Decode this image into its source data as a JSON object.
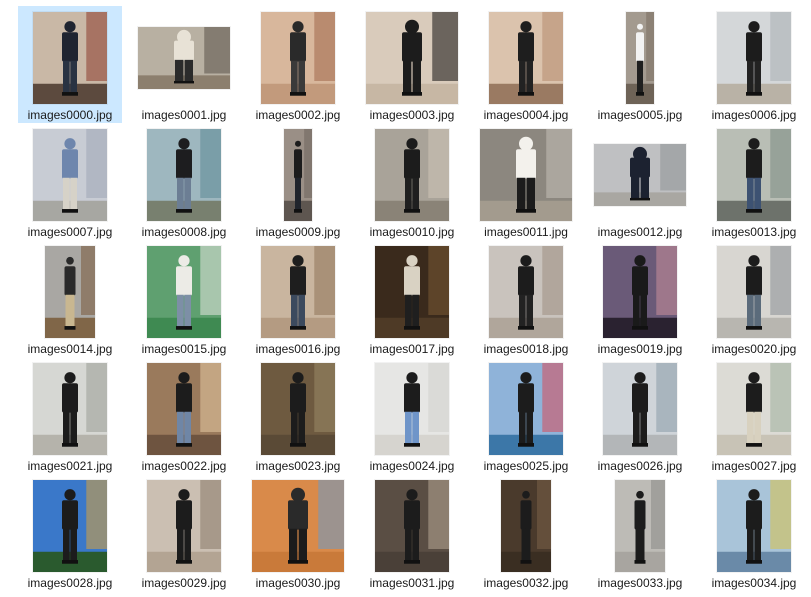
{
  "window": {
    "view": "Large icons",
    "selected_index": 0
  },
  "files": [
    {
      "name": "images0000.jpg",
      "shape": "portrait",
      "scene": {
        "bg": "#c9b8a6",
        "accent": "#8a3b2b",
        "floor": "#5c4a3e",
        "figure": "#1f2430",
        "legs": "#2a3342"
      }
    },
    {
      "name": "images0001.jpg",
      "shape": "landscape",
      "scene": {
        "bg": "#b8b0a2",
        "accent": "#5a5248",
        "floor": "#8c7f6e",
        "figure": "#e8e2d6",
        "legs": "#2b2b2b"
      }
    },
    {
      "name": "images0002.jpg",
      "shape": "portrait",
      "scene": {
        "bg": "#d8b79c",
        "accent": "#a0674a",
        "floor": "#c29a7c",
        "figure": "#2a2a2a",
        "legs": "#3a3a3a"
      }
    },
    {
      "name": "images0003.jpg",
      "shape": "landscape-tall",
      "scene": {
        "bg": "#d9cbbb",
        "accent": "#111111",
        "floor": "#c7b7a4",
        "figure": "#1c1c1c",
        "legs": "#1c1c1c"
      }
    },
    {
      "name": "images0004.jpg",
      "shape": "portrait",
      "scene": {
        "bg": "#dbc3ad",
        "accent": "#b58a6e",
        "floor": "#9a7a62",
        "figure": "#1e1e1e",
        "legs": "#222222"
      }
    },
    {
      "name": "images0005.jpg",
      "shape": "narrow",
      "scene": {
        "bg": "#a39a8f",
        "accent": "#7a6d60",
        "floor": "#6e6357",
        "figure": "#f2f2f2",
        "legs": "#1f1f1f"
      }
    },
    {
      "name": "images0006.jpg",
      "shape": "portrait",
      "scene": {
        "bg": "#d4d7d9",
        "accent": "#a8aeb3",
        "floor": "#b9b2a6",
        "figure": "#1c1c1c",
        "legs": "#222222"
      }
    },
    {
      "name": "images0007.jpg",
      "shape": "portrait",
      "scene": {
        "bg": "#c8ccd4",
        "accent": "#9ea6b4",
        "floor": "#a7a7a2",
        "figure": "#6e86ad",
        "legs": "#d6d2c8"
      }
    },
    {
      "name": "images0008.jpg",
      "shape": "portrait",
      "scene": {
        "bg": "#9eb7bf",
        "accent": "#5d8a96",
        "floor": "#78806f",
        "figure": "#1d1d1f",
        "legs": "#6c7e94"
      }
    },
    {
      "name": "images0009.jpg",
      "shape": "narrow",
      "scene": {
        "bg": "#9a8f86",
        "accent": "#6e655c",
        "floor": "#5e5650",
        "figure": "#1c1c1c",
        "legs": "#20242c"
      }
    },
    {
      "name": "images0010.jpg",
      "shape": "portrait",
      "scene": {
        "bg": "#a9a399",
        "accent": "#cfc7b8",
        "floor": "#8a8377",
        "figure": "#1c1c1c",
        "legs": "#1f1f1f"
      }
    },
    {
      "name": "images0011.jpg",
      "shape": "landscape-tall",
      "scene": {
        "bg": "#8c877f",
        "accent": "#c5c0b8",
        "floor": "#a39b8e",
        "figure": "#f3f1ec",
        "legs": "#1c1c1c"
      }
    },
    {
      "name": "images0012.jpg",
      "shape": "landscape",
      "scene": {
        "bg": "#bfc0c2",
        "accent": "#8e9196",
        "floor": "#a9a7a2",
        "figure": "#1c2230",
        "legs": "#1c2230"
      }
    },
    {
      "name": "images0013.jpg",
      "shape": "portrait",
      "scene": {
        "bg": "#b9beb5",
        "accent": "#7c8a82",
        "floor": "#6d726b",
        "figure": "#1c1c1c",
        "legs": "#3d5272"
      }
    },
    {
      "name": "images0014.jpg",
      "shape": "narrow-wide",
      "scene": {
        "bg": "#a9a7a3",
        "accent": "#7a5a3c",
        "floor": "#806648",
        "figure": "#2a2a2a",
        "legs": "#c9b790"
      }
    },
    {
      "name": "images0015.jpg",
      "shape": "portrait",
      "scene": {
        "bg": "#5fa070",
        "accent": "#e3e6e0",
        "floor": "#3f8a52",
        "figure": "#ecebe6",
        "legs": "#7d8fa6"
      }
    },
    {
      "name": "images0016.jpg",
      "shape": "portrait",
      "scene": {
        "bg": "#c9b59f",
        "accent": "#8e7358",
        "floor": "#b49b82",
        "figure": "#1e1e1e",
        "legs": "#3c4a5e"
      }
    },
    {
      "name": "images0017.jpg",
      "shape": "portrait",
      "scene": {
        "bg": "#3a2a1c",
        "accent": "#7a5a34",
        "floor": "#4e3a26",
        "figure": "#d9d2c3",
        "legs": "#1f1f1f"
      }
    },
    {
      "name": "images0018.jpg",
      "shape": "portrait",
      "scene": {
        "bg": "#c9c3bd",
        "accent": "#9c8e82",
        "floor": "#b0a69b",
        "figure": "#1c1c1c",
        "legs": "#222222"
      }
    },
    {
      "name": "images0019.jpg",
      "shape": "portrait",
      "scene": {
        "bg": "#6a5a78",
        "accent": "#c88f9a",
        "floor": "#2a2230",
        "figure": "#1a1a1a",
        "legs": "#1a1a1a"
      }
    },
    {
      "name": "images0020.jpg",
      "shape": "portrait",
      "scene": {
        "bg": "#d8d6d1",
        "accent": "#8a8f96",
        "floor": "#b8b6b0",
        "figure": "#1c1c1c",
        "legs": "#5b6b7b"
      }
    },
    {
      "name": "images0021.jpg",
      "shape": "portrait",
      "scene": {
        "bg": "#d6d7d3",
        "accent": "#9a9c96",
        "floor": "#b5b3ab",
        "figure": "#1c1c1c",
        "legs": "#1c1c1c"
      }
    },
    {
      "name": "images0022.jpg",
      "shape": "portrait",
      "scene": {
        "bg": "#9a7a5c",
        "accent": "#e6c9a2",
        "floor": "#6e5440",
        "figure": "#1c1c1c",
        "legs": "#6f86a6"
      }
    },
    {
      "name": "images0023.jpg",
      "shape": "portrait",
      "scene": {
        "bg": "#6e5a40",
        "accent": "#9a8a66",
        "floor": "#5a4a36",
        "figure": "#1c1c1c",
        "legs": "#1c1c1c"
      }
    },
    {
      "name": "images0024.jpg",
      "shape": "portrait",
      "scene": {
        "bg": "#e6e6e4",
        "accent": "#cfcfcc",
        "floor": "#d6d4cf",
        "figure": "#1c1c1c",
        "legs": "#6f95c9"
      }
    },
    {
      "name": "images0025.jpg",
      "shape": "portrait",
      "scene": {
        "bg": "#8fb3d9",
        "accent": "#d94a5a",
        "floor": "#3c77a8",
        "figure": "#1c1c1c",
        "legs": "#1c1c1c"
      }
    },
    {
      "name": "images0026.jpg",
      "shape": "portrait",
      "scene": {
        "bg": "#cfd4d9",
        "accent": "#8a9aa8",
        "floor": "#b3b6b8",
        "figure": "#1c1c1c",
        "legs": "#1c1c1c"
      }
    },
    {
      "name": "images0027.jpg",
      "shape": "portrait",
      "scene": {
        "bg": "#dcdbd5",
        "accent": "#9fae9c",
        "floor": "#c8c3b6",
        "figure": "#1c1c1c",
        "legs": "#d8d1bf"
      }
    },
    {
      "name": "images0028.jpg",
      "shape": "portrait",
      "scene": {
        "bg": "#3a78c9",
        "accent": "#d9a23a",
        "floor": "#2a5a2e",
        "figure": "#1c1c1c",
        "legs": "#1c1c1c"
      }
    },
    {
      "name": "images0029.jpg",
      "shape": "portrait",
      "scene": {
        "bg": "#cbbfb2",
        "accent": "#8a7a6a",
        "floor": "#b3a493",
        "figure": "#1c1c1c",
        "legs": "#1c1c1c"
      }
    },
    {
      "name": "images0030.jpg",
      "shape": "landscape-tall",
      "scene": {
        "bg": "#d98a4a",
        "accent": "#6a9ac9",
        "floor": "#c97a3a",
        "figure": "#2a2a2a",
        "legs": "#1c1c1c"
      }
    },
    {
      "name": "images0031.jpg",
      "shape": "portrait",
      "scene": {
        "bg": "#5a4e44",
        "accent": "#b8a896",
        "floor": "#4a4038",
        "figure": "#1c1c1c",
        "legs": "#1c1c1c"
      }
    },
    {
      "name": "images0032.jpg",
      "shape": "narrow-wide",
      "scene": {
        "bg": "#4a3a2c",
        "accent": "#7a6048",
        "floor": "#3a2e22",
        "figure": "#1c1c1c",
        "legs": "#1c1c1c"
      }
    },
    {
      "name": "images0033.jpg",
      "shape": "narrow-wide",
      "scene": {
        "bg": "#bdbbb6",
        "accent": "#8a8a86",
        "floor": "#a8a5a0",
        "figure": "#1c1c1c",
        "legs": "#1c1c1c"
      }
    },
    {
      "name": "images0034.jpg",
      "shape": "portrait",
      "scene": {
        "bg": "#a9c4d9",
        "accent": "#d9c24a",
        "floor": "#6a8aa8",
        "figure": "#1c1c1c",
        "legs": "#1c1c1c"
      }
    }
  ]
}
